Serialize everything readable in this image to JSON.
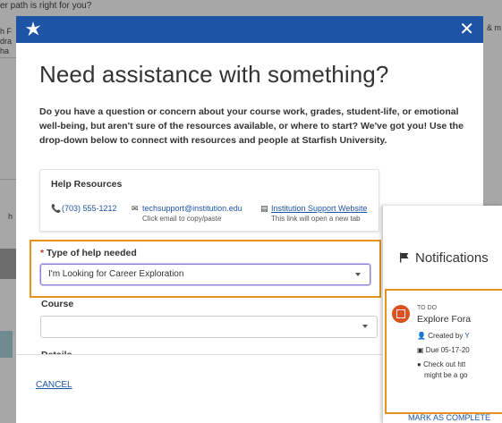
{
  "background": {
    "top_text": "er path is right for you?",
    "side_left": [
      "h F",
      "dra",
      "ha"
    ],
    "side_right": "& m",
    "side_marker": "h"
  },
  "modal": {
    "title": "Need assistance with something?",
    "intro": "Do you have a question or concern about your course work, grades, student-life, or emotional well-being, but aren't sure of the resources available, or where to start? We've got you! Use the drop-down below to connect with resources and people at Starfish University.",
    "close_glyph": "✕",
    "help": {
      "title": "Help Resources",
      "phone": "(703) 555-1212",
      "email": "techsupport@institution.edu",
      "email_hint": "Click email to copy/paste",
      "website": "Institution Support Website",
      "website_hint": "This link will open a new tab"
    },
    "type_field": {
      "required_mark": "*",
      "label": "Type of help needed",
      "value": "I'm Looking for Career Exploration"
    },
    "course_field": {
      "label": "Course",
      "value": ""
    },
    "details_field": {
      "label": "Details"
    },
    "cancel_label": "CANCEL"
  },
  "notifications": {
    "title": "Notifications",
    "item": {
      "tag": "TO DO",
      "name": "Explore Fora",
      "created_prefix": "Created by",
      "created_link": "Y",
      "due": "Due 05-17-20",
      "info_line1": "Check out htt",
      "info_line2": "might be a go"
    },
    "mark_complete": "MARK AS COMPLETE"
  },
  "colors": {
    "header_blue": "#1e54a6",
    "highlight_orange": "#e6921e",
    "todo_badge": "#d9531e",
    "link_blue": "#1e54a6"
  }
}
